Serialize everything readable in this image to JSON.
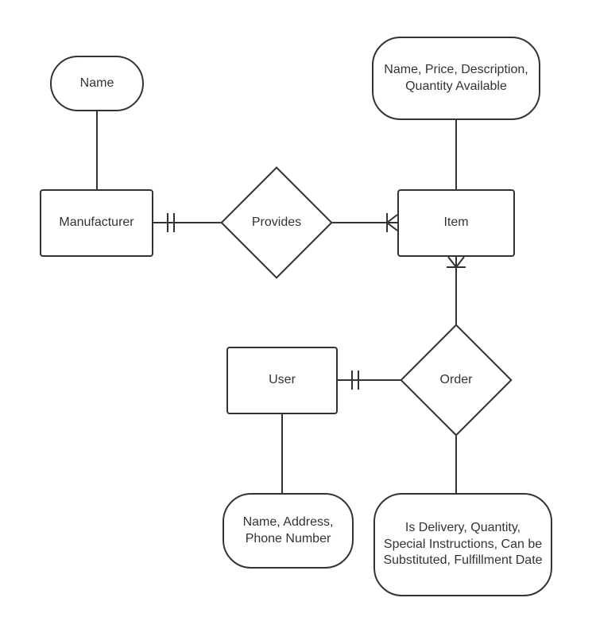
{
  "entities": {
    "manufacturer": {
      "label": "Manufacturer"
    },
    "item": {
      "label": "Item"
    },
    "user": {
      "label": "User"
    }
  },
  "relationships": {
    "provides": {
      "label": "Provides"
    },
    "order": {
      "label": "Order"
    }
  },
  "attributes": {
    "manufacturer_attrs": {
      "label": "Name"
    },
    "item_attrs": {
      "label": "Name, Price, Description, Quantity Available"
    },
    "user_attrs": {
      "label": "Name, Address, Phone Number"
    },
    "order_attrs": {
      "label": "Is Delivery, Quantity, Special Instructions, Can be Substituted, Fulfillment Date"
    }
  },
  "er_model": {
    "entities": [
      {
        "name": "Manufacturer",
        "attributes": [
          "Name"
        ]
      },
      {
        "name": "Item",
        "attributes": [
          "Name",
          "Price",
          "Description",
          "Quantity Available"
        ]
      },
      {
        "name": "User",
        "attributes": [
          "Name",
          "Address",
          "Phone Number"
        ]
      }
    ],
    "relationships": [
      {
        "name": "Provides",
        "between": [
          "Manufacturer",
          "Item"
        ],
        "cardinality": {
          "Manufacturer": "one",
          "Item": "many"
        }
      },
      {
        "name": "Order",
        "between": [
          "User",
          "Item"
        ],
        "cardinality": {
          "User": "one",
          "Item": "many"
        },
        "attributes": [
          "Is Delivery",
          "Quantity",
          "Special Instructions",
          "Can be Substituted",
          "Fulfillment Date"
        ]
      }
    ]
  }
}
